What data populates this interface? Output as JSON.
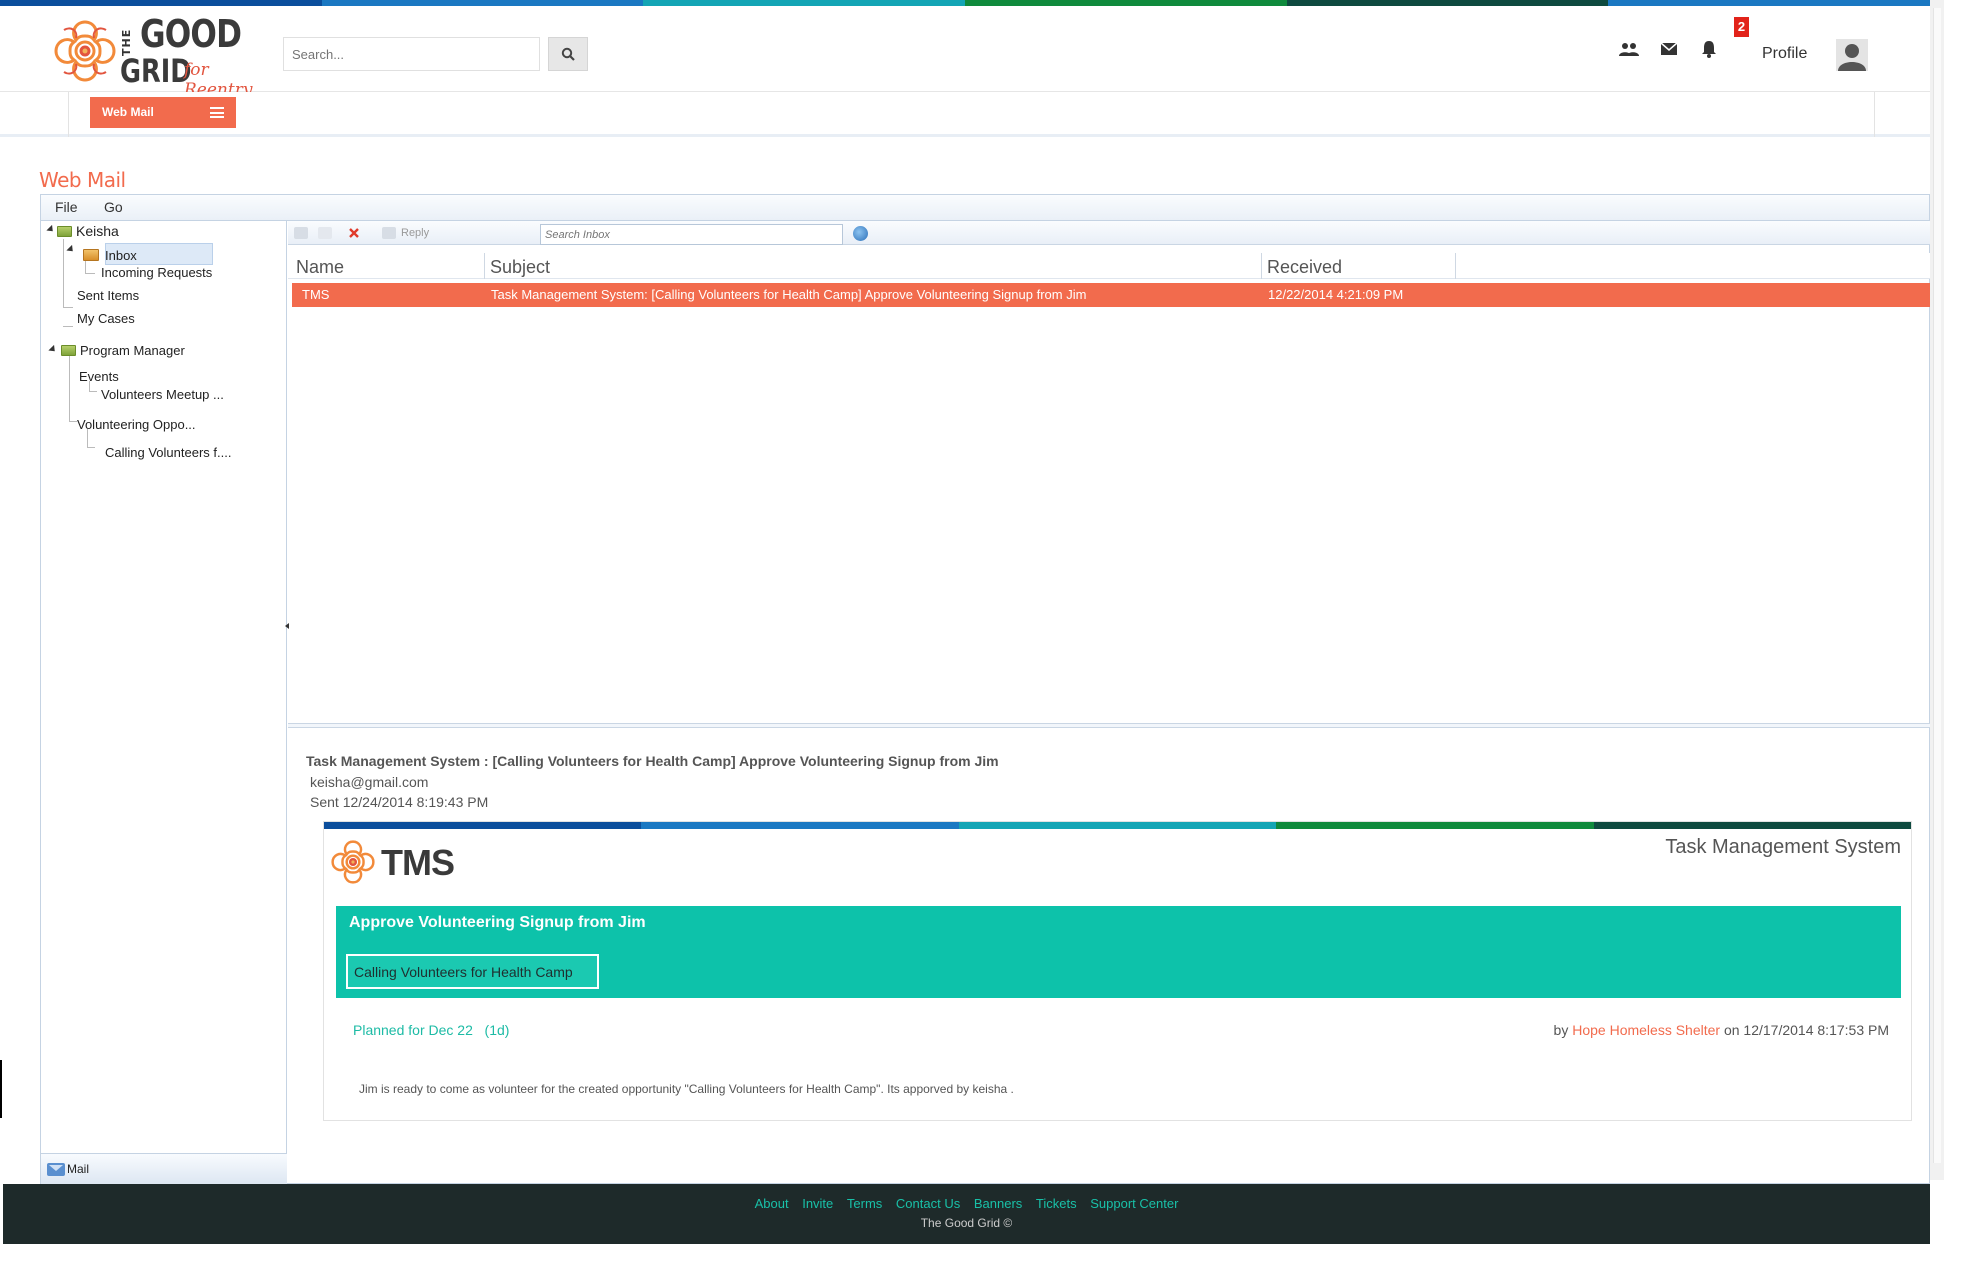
{
  "brand": {
    "logo_top": "GOOD",
    "logo_bottom": "GRID",
    "logo_the": "THE",
    "logo_tagline": "for Reentry",
    "stripe_colors": [
      "#0b4e9c",
      "#1a78c2",
      "#14a5b5",
      "#0f8a3c",
      "#0e4a3f",
      "#1a78c2"
    ]
  },
  "header": {
    "search_placeholder": "Search...",
    "notification_count": "2",
    "profile_label": "Profile",
    "icons": [
      "users-icon",
      "envelope-icon",
      "bell-icon",
      "avatar-icon"
    ]
  },
  "toolbar": {
    "webmail_button": "Web Mail"
  },
  "page": {
    "title": "Web Mail"
  },
  "menubar": {
    "file": "File",
    "go": "Go"
  },
  "folders": {
    "root": "Keisha",
    "inbox": "Inbox",
    "incoming_requests": "Incoming Requests",
    "sent_items": "Sent Items",
    "my_cases": "My Cases",
    "program_manager": "Program Manager",
    "events": "Events",
    "volunteers_meetup": "Volunteers Meetup ...",
    "volunteering_oppo": "Volunteering Oppo...",
    "calling_volunteers": "Calling Volunteers f...."
  },
  "mail_tab": "Mail",
  "grid_toolbar": {
    "reply": "Reply",
    "search_placeholder": "Search Inbox"
  },
  "columns": {
    "name": "Name",
    "subject": "Subject",
    "received": "Received"
  },
  "messages": [
    {
      "name": "TMS",
      "subject": "Task Management System: [Calling Volunteers for Health Camp] Approve Volunteering Signup from Jim",
      "received": "12/22/2014 4:21:09 PM"
    }
  ],
  "preview": {
    "subject": "Task Management System : [Calling Volunteers for Health Camp] Approve Volunteering Signup from Jim",
    "from": "keisha@gmail.com",
    "sent": "Sent 12/24/2014 8:19:43 PM",
    "card": {
      "logo_text": "TMS",
      "system_name": "Task Management System",
      "banner_title": "Approve Volunteering Signup from Jim",
      "opportunity_chip": "Calling Volunteers for Health Camp",
      "planned": "Planned for Dec 22",
      "duration": "(1d)",
      "by_prefix": "by",
      "by_org": "Hope Homeless Shelter",
      "by_suffix": "on 12/17/2014 8:17:53 PM",
      "description": "Jim is ready to come as volunteer for the created opportunity \"Calling Volunteers for Health Camp\". Its apporved by keisha ."
    }
  },
  "footer": {
    "links": [
      "About",
      "Invite",
      "Terms",
      "Contact Us",
      "Banners",
      "Tickets",
      "Support Center"
    ],
    "copyright": "The Good Grid ©"
  },
  "colors": {
    "accent": "#f26b4d",
    "teal": "#0dc2aa",
    "footer_bg": "#1e2a2a"
  }
}
